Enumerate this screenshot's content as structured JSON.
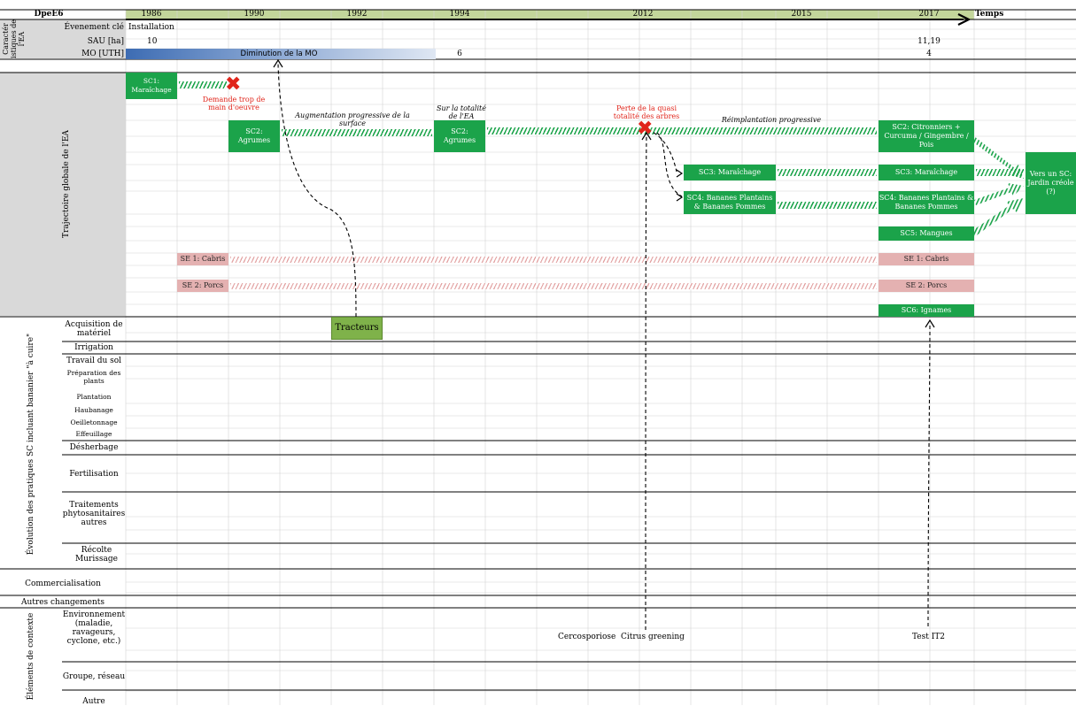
{
  "header": {
    "code": "DpeE6",
    "years": [
      "1986",
      "1990",
      "1992",
      "1994",
      "2012",
      "2015",
      "2017"
    ],
    "axis_end_label": "Temps"
  },
  "characteristics": {
    "section_label": "Caractér istiques de l'EA",
    "rows": {
      "event_label": "Évenement clé",
      "event_value_1986": "Installation",
      "sau_label": "SAU [ha]",
      "sau_1986": "10",
      "sau_2017": "11,19",
      "mo_label": "MO [UTH]",
      "mo_bar_label": "Diminution de la MO",
      "mo_1994": "6",
      "mo_2017": "4"
    }
  },
  "trajectory": {
    "section_label": "Trajectoire globale de l'EA",
    "boxes": {
      "sc1": "SC1: Maraîchage",
      "sc2_1990": "SC2: Agrumes",
      "sc2_1994": "SC2: Agrumes",
      "sc3_2012": "SC3: Maraîchage",
      "sc4_2012": "SC4: Bananes Plantains & Bananes Pommes",
      "sc2_2017": "SC2: Citronniers + Curcuma / Gingembre / Pois",
      "sc3_2017": "SC3: Maraîchage",
      "sc4_2017": "SC4: Bananes Plantains & Bananes Pommes",
      "sc5_2017": "SC5: Mangues",
      "vers": "Vers un SC: Jardin créole (?)",
      "se1": "SE 1: Cabris",
      "se2": "SE 2: Porcs",
      "se1_2017": "SE 1: Cabris",
      "se2_2017": "SE 2: Porcs",
      "sc6_2017": "SC6: Ignames"
    },
    "annotations": {
      "demande": "Demande trop de main d'oeuvre",
      "augmentation": "Augmentation progressive de la surface",
      "totalite": "Sur la totalité de l'EA",
      "perte": "Perte de la quasi totalité des arbres",
      "reimplantation": "Réimplantation progressive"
    }
  },
  "practices": {
    "section_label": "Évolution des pratiques SC incluant bananier \"à cuire\"",
    "rows": [
      "Acquisition de matériel",
      "Irrigation",
      "Travail du sol",
      "Préparation des plants",
      "Plantation",
      "Haubanage",
      "Oeilletonnage",
      "Effeuillage",
      "Désherbage",
      "Fertilisation",
      "Traitements phytosanitaires autres",
      "Récolte Murissage"
    ],
    "tracteurs": "Tracteurs"
  },
  "commercialisation": "Commercialisation",
  "autres_changements": "Autres changements",
  "context": {
    "section_label": "Éléments de contexte",
    "rows": [
      "Environnement (maladie, ravageurs, cyclone, etc.)",
      "Groupe, réseau",
      "Autre"
    ],
    "cercosporiose": "Cercosporiose",
    "citrus": "Citrus greening",
    "test_it2": "Test IT2"
  },
  "colors": {
    "green": "#1ba34a",
    "header_green": "#c3d69b",
    "pink": "#e4b1b1",
    "olive": "#7fb24a",
    "grey": "#d9d9d9",
    "red": "#e0251b"
  }
}
